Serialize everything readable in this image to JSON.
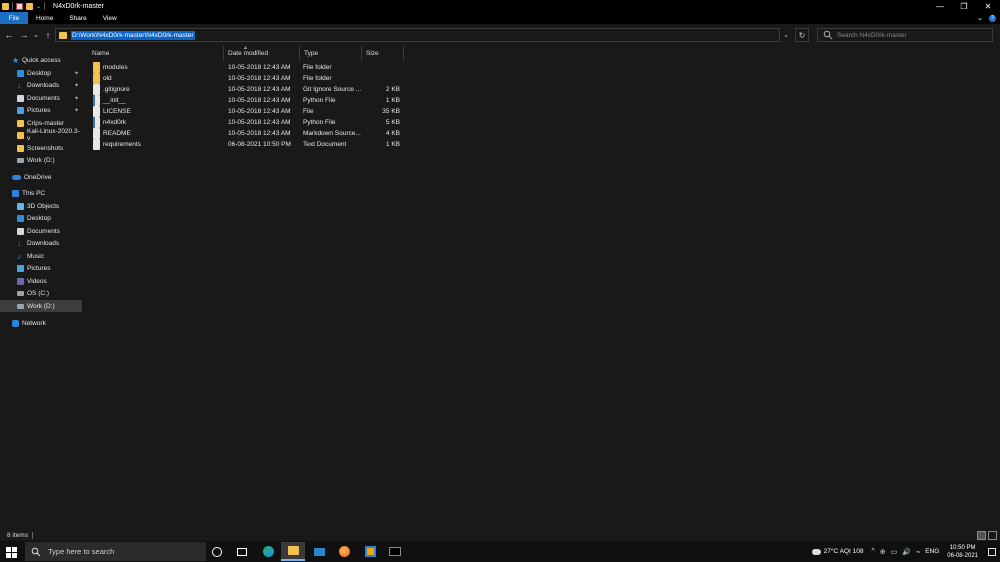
{
  "window": {
    "title": "N4xD0rk-master",
    "controls": {
      "minimize": "—",
      "maximize": "❐",
      "close": "✕"
    }
  },
  "ribbon": {
    "tabs": [
      "File",
      "Home",
      "Share",
      "View"
    ],
    "expand_glyph": "⌄",
    "help_glyph": "?"
  },
  "nav_buttons": {
    "back": "←",
    "forward": "→",
    "recent": "⌄",
    "up": "↑"
  },
  "address": {
    "path": "D:\\Work\\N4xD0rk-master\\N4xD0rk-master",
    "dropdown_glyph": "⌄",
    "refresh_glyph": "↻"
  },
  "search": {
    "placeholder": "Search N4xD0rk-master"
  },
  "navpane": {
    "items": [
      {
        "label": "Quick access",
        "icon": "star-icon",
        "pinned": false
      },
      {
        "label": "Desktop",
        "icon": "desktop-icon",
        "pinned": true
      },
      {
        "label": "Downloads",
        "icon": "downloads-icon",
        "pinned": true
      },
      {
        "label": "Documents",
        "icon": "documents-icon",
        "pinned": true
      },
      {
        "label": "Pictures",
        "icon": "pictures-icon",
        "pinned": true
      },
      {
        "label": "Crips-master",
        "icon": "folder-icon",
        "pinned": false
      },
      {
        "label": "Kali-Linux-2020.3-v",
        "icon": "folder-icon",
        "pinned": false
      },
      {
        "label": "Screenshots",
        "icon": "folder-icon",
        "pinned": false
      },
      {
        "label": "Work (D:)",
        "icon": "drive-icon",
        "pinned": false
      },
      {
        "label": "OneDrive",
        "icon": "onedrive-icon",
        "pinned": false
      },
      {
        "label": "This PC",
        "icon": "pc-icon",
        "pinned": false
      },
      {
        "label": "3D Objects",
        "icon": "3d-objects-icon",
        "pinned": false
      },
      {
        "label": "Desktop",
        "icon": "desktop-icon",
        "pinned": false
      },
      {
        "label": "Documents",
        "icon": "documents-icon",
        "pinned": false
      },
      {
        "label": "Downloads",
        "icon": "downloads-icon",
        "pinned": false
      },
      {
        "label": "Music",
        "icon": "music-icon",
        "pinned": false
      },
      {
        "label": "Pictures",
        "icon": "pictures-icon",
        "pinned": false
      },
      {
        "label": "Videos",
        "icon": "videos-icon",
        "pinned": false
      },
      {
        "label": "OS (C:)",
        "icon": "drive-icon",
        "pinned": false
      },
      {
        "label": "Work (D:)",
        "icon": "drive-icon",
        "pinned": false,
        "selected": true
      },
      {
        "label": "Network",
        "icon": "network-icon",
        "pinned": false
      }
    ],
    "pin_glyph": "📌"
  },
  "files": {
    "columns": [
      "Name",
      "Date modified",
      "Type",
      "Size"
    ],
    "rows": [
      {
        "name": "modules",
        "date": "10-05-2018 12:43 AM",
        "type": "File folder",
        "size": "",
        "icon": "folder-icon"
      },
      {
        "name": "old",
        "date": "10-05-2018 12:43 AM",
        "type": "File folder",
        "size": "",
        "icon": "folder-icon"
      },
      {
        "name": ".gitignore",
        "date": "10-05-2018 12:43 AM",
        "type": "Git Ignore Source ...",
        "size": "2 KB",
        "icon": "file-icon"
      },
      {
        "name": "__init__",
        "date": "10-05-2018 12:43 AM",
        "type": "Python File",
        "size": "1 KB",
        "icon": "python-file-icon"
      },
      {
        "name": "LICENSE",
        "date": "10-05-2018 12:43 AM",
        "type": "File",
        "size": "35 KB",
        "icon": "file-icon"
      },
      {
        "name": "n4xd0rk",
        "date": "10-05-2018 12:43 AM",
        "type": "Python File",
        "size": "5 KB",
        "icon": "python-file-icon"
      },
      {
        "name": "README",
        "date": "10-05-2018 12:43 AM",
        "type": "Markdown Source...",
        "size": "4 KB",
        "icon": "markdown-file-icon"
      },
      {
        "name": "requirements",
        "date": "06-08-2021 10:50 PM",
        "type": "Text Document",
        "size": "1 KB",
        "icon": "text-file-icon"
      }
    ]
  },
  "status": {
    "items_count": "8 items"
  },
  "taskbar": {
    "search_placeholder": "Type here to search",
    "weather": "27°C  AQI 108",
    "language": "ENG",
    "time": "10:50 PM",
    "date": "06-08-2021",
    "tray_glyphs": [
      "^",
      "⊕",
      "▭",
      "🔊",
      "⌁"
    ]
  },
  "colors": {
    "accent": "#0a64c8",
    "file_tab": "#1b6ec2",
    "background": "#191919",
    "folder": "#f2c14e"
  }
}
